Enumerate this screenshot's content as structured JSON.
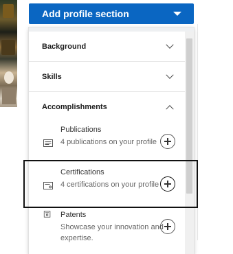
{
  "add_button": {
    "label": "Add profile section"
  },
  "sections": [
    {
      "title": "Background",
      "state": "collapsed"
    },
    {
      "title": "Skills",
      "state": "collapsed"
    },
    {
      "title": "Accomplishments",
      "state": "expanded"
    }
  ],
  "accomplishments": [
    {
      "name": "Publications",
      "desc": "4 publications on your profile",
      "icon": "publication-icon"
    },
    {
      "name": "Certifications",
      "desc": "4 certifications on your profile",
      "icon": "certificate-icon",
      "highlighted": true
    },
    {
      "name": "Patents",
      "desc": "Showcase your innovation and expertise.",
      "icon": "patent-icon"
    }
  ],
  "colors": {
    "primary": "#0a66c2",
    "text": "#333333",
    "muted": "#666666"
  }
}
